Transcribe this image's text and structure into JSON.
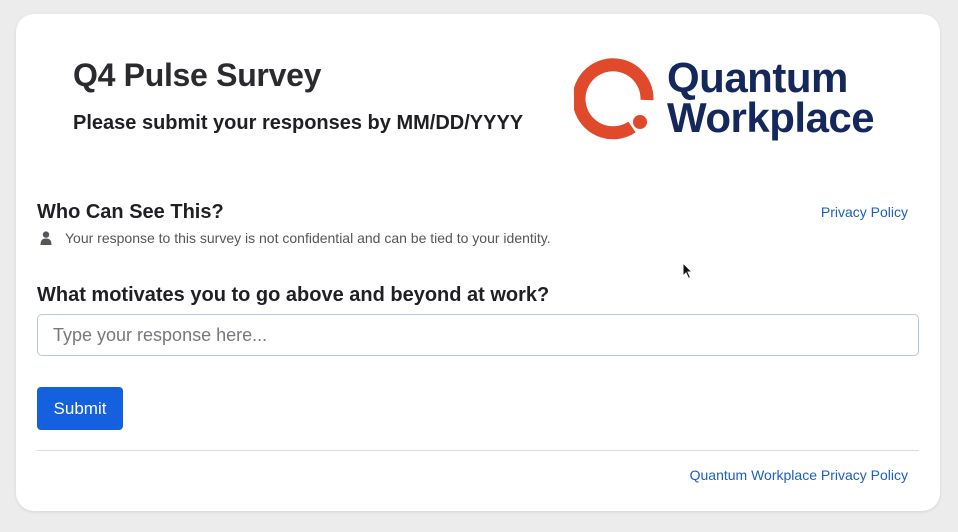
{
  "survey": {
    "title": "Q4 Pulse Survey",
    "deadline": "Please submit your responses by MM/DD/YYYY"
  },
  "logo": {
    "line1": "Quantum",
    "line2": "Workplace",
    "ring_color": "#e0492a",
    "text_color": "#15285c",
    "icon": "quantum-workplace-logo-icon"
  },
  "visibility": {
    "title": "Who Can See This?",
    "privacy_link": "Privacy Policy",
    "notice": "Your response to this survey is not confidential and can be tied to your identity.",
    "icon": "person-icon"
  },
  "question": {
    "text": "What motivates you to go above and beyond at work?",
    "value": "",
    "placeholder": "Type your response here..."
  },
  "actions": {
    "submit_label": "Submit",
    "primary_color": "#1560de"
  },
  "footer": {
    "privacy_link": "Quantum Workplace Privacy Policy",
    "link_color": "#1b5fc1"
  }
}
